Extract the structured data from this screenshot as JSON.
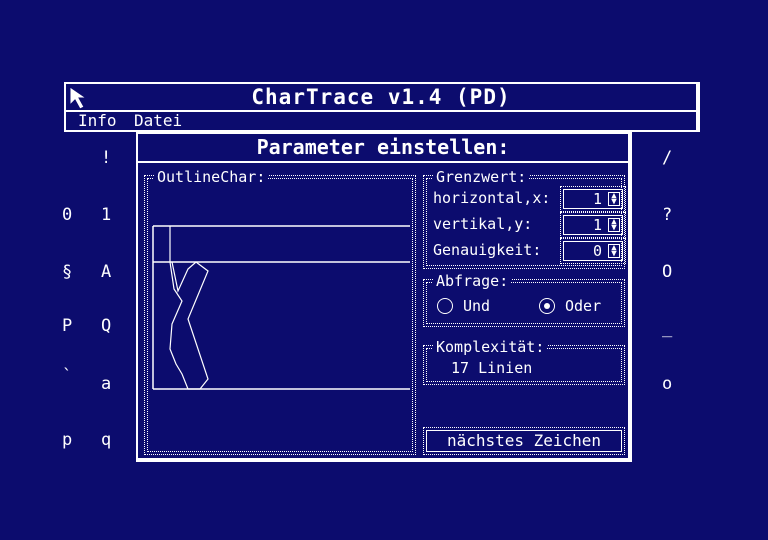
{
  "app": {
    "title": "CharTrace v1.4 (PD)"
  },
  "menu": {
    "items": [
      "Info",
      "Datei"
    ]
  },
  "background_glyphs": {
    "left_col1": [
      "0",
      "§",
      "P",
      "`",
      "p"
    ],
    "left_col2": [
      "!",
      "1",
      "A",
      "Q",
      "a",
      "q"
    ],
    "right_col": [
      "/",
      "?",
      "O",
      "_",
      "o"
    ]
  },
  "dialog": {
    "title": "Parameter einstellen:",
    "outline": {
      "label": "OutlineChar:"
    },
    "grenzwert": {
      "label": "Grenzwert:",
      "horizontal_label": "horizontal,x:",
      "horizontal_value": "1",
      "vertikal_label": "vertikal,y:",
      "vertikal_value": "1",
      "genauigkeit_label": "Genauigkeit:",
      "genauigkeit_value": "0"
    },
    "abfrage": {
      "label": "Abfrage:",
      "und": "Und",
      "oder": "Oder",
      "selected": "Oder"
    },
    "komplexitaet": {
      "label": "Komplexität:",
      "value": "17 Linien"
    },
    "next_button": "nächstes Zeichen"
  },
  "colors": {
    "background": "#0c0c6e",
    "foreground": "#ffffff"
  }
}
